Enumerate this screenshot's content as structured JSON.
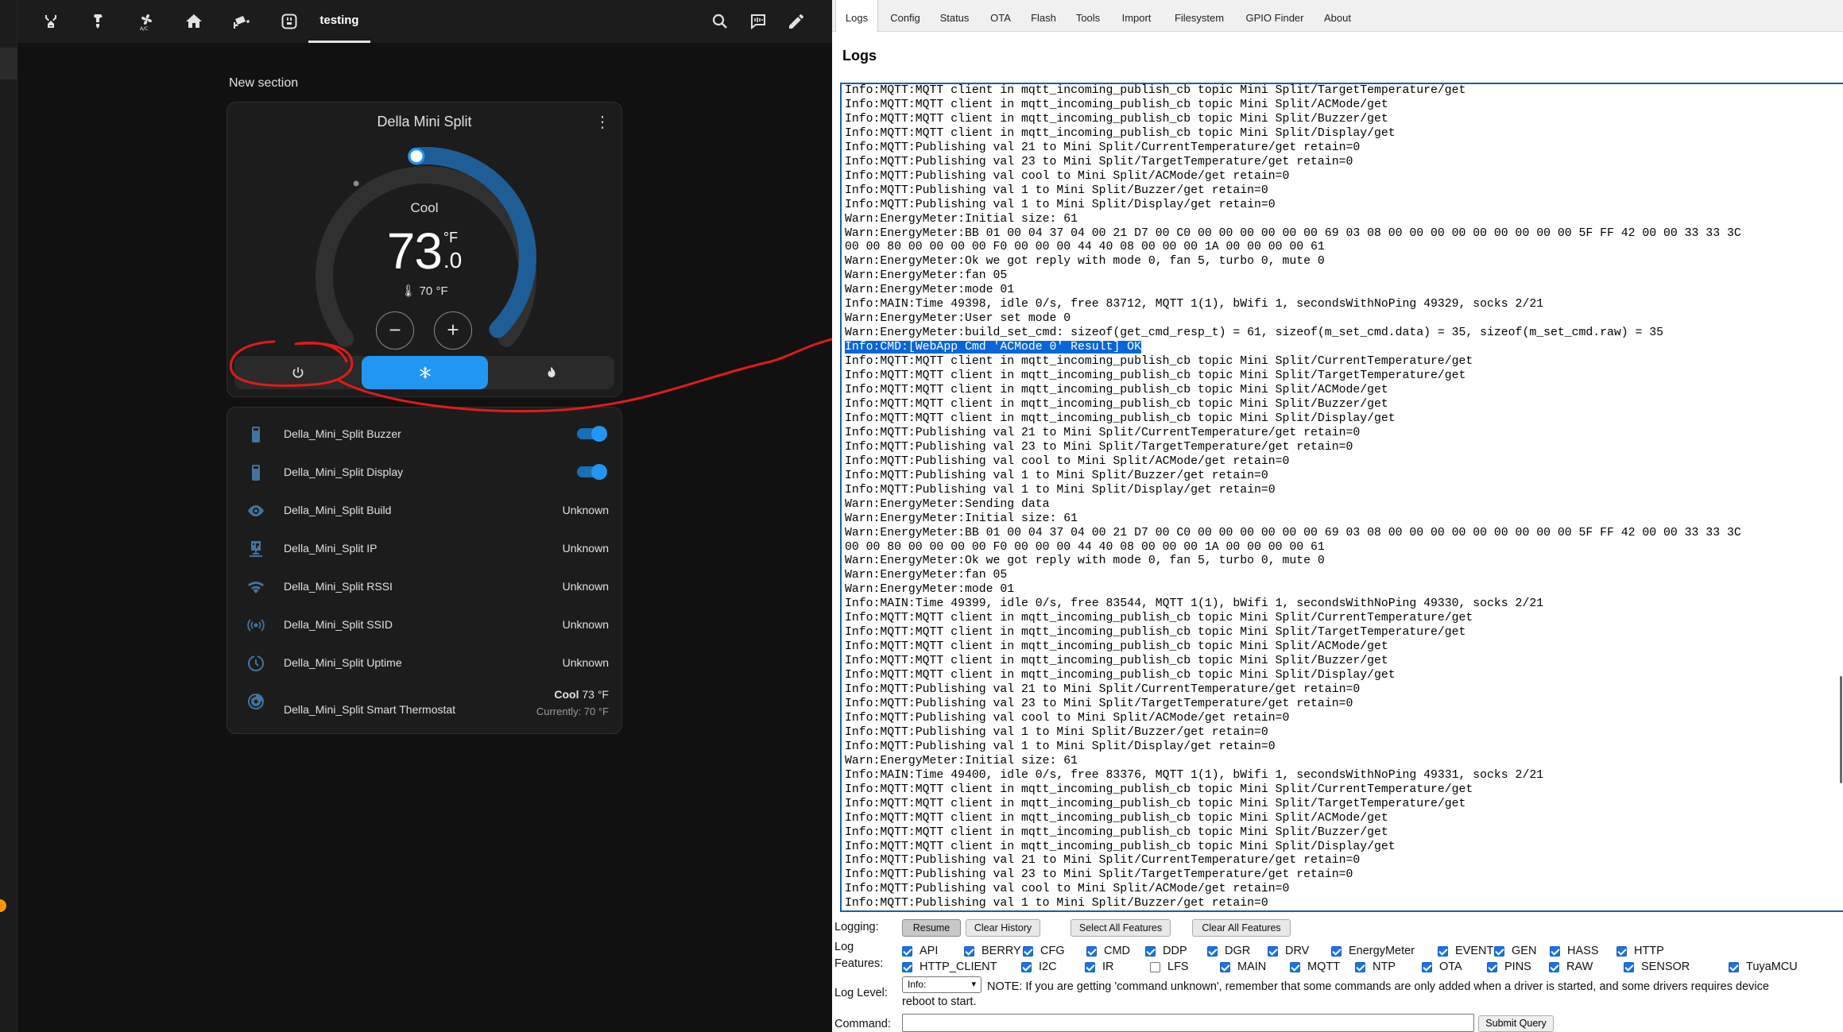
{
  "ha": {
    "tabs": [
      {
        "icon": "robot-vacuum-icon"
      },
      {
        "icon": "water-pump-icon"
      },
      {
        "icon": "ac-fan-icon"
      },
      {
        "icon": "home-icon"
      },
      {
        "icon": "cctv-icon"
      },
      {
        "icon": "power-socket-icon"
      },
      {
        "label": "testing",
        "active": true
      }
    ],
    "top_actions": [
      "search-icon",
      "assist-icon",
      "edit-pencil-icon"
    ],
    "section_title": "New section",
    "thermostat": {
      "name": "Della Mini Split",
      "mode_label": "Cool",
      "target_whole": "73",
      "target_decimal": ".0",
      "unit": "°F",
      "current": "70 °F",
      "minus": "−",
      "plus": "+",
      "modes": [
        "power-icon",
        "snowflake-icon",
        "fire-icon"
      ],
      "selected_mode": "cool",
      "dial_value": 73
    },
    "entities": [
      {
        "icon": "remote-icon",
        "name": "Della_Mini_Split Buzzer",
        "toggle": true
      },
      {
        "icon": "remote-icon",
        "name": "Della_Mini_Split Display",
        "toggle": true
      },
      {
        "icon": "eye-icon",
        "name": "Della_Mini_Split Build",
        "state": "Unknown"
      },
      {
        "icon": "ip-network-icon",
        "name": "Della_Mini_Split IP",
        "state": "Unknown"
      },
      {
        "icon": "wifi-icon",
        "name": "Della_Mini_Split RSSI",
        "state": "Unknown"
      },
      {
        "icon": "access-point-icon",
        "name": "Della_Mini_Split SSID",
        "state": "Unknown"
      },
      {
        "icon": "clock-icon",
        "name": "Della_Mini_Split Uptime",
        "state": "Unknown"
      },
      {
        "icon": "thermostat-icon",
        "name": "Della_Mini_Split Smart Thermostat",
        "state_bold": "Cool",
        "state_value": " 73 °F",
        "state_sub": "Currently: 70 °F"
      }
    ],
    "colors": {
      "accent": "#2196f3",
      "annotation": "#e01b1b"
    }
  },
  "obk": {
    "nav": [
      "Logs",
      "Config",
      "Status",
      "OTA",
      "Flash",
      "Tools",
      "Import",
      "Filesystem",
      "GPIO Finder",
      "About"
    ],
    "heading": "Logs",
    "log_lines": [
      "Info:MQTT:MQTT client in mqtt_incoming_publish_cb topic Mini Split/TargetTemperature/get",
      "Info:MQTT:MQTT client in mqtt_incoming_publish_cb topic Mini Split/ACMode/get",
      "Info:MQTT:MQTT client in mqtt_incoming_publish_cb topic Mini Split/Buzzer/get",
      "Info:MQTT:MQTT client in mqtt_incoming_publish_cb topic Mini Split/Display/get",
      "Info:MQTT:Publishing val 21 to Mini Split/CurrentTemperature/get retain=0",
      "Info:MQTT:Publishing val 23 to Mini Split/TargetTemperature/get retain=0",
      "Info:MQTT:Publishing val cool to Mini Split/ACMode/get retain=0",
      "Info:MQTT:Publishing val 1 to Mini Split/Buzzer/get retain=0",
      "Info:MQTT:Publishing val 1 to Mini Split/Display/get retain=0",
      "Warn:EnergyMeter:Initial size: 61",
      "Warn:EnergyMeter:BB 01 00 04 37 04 00 21 D7 00 C0 00 00 00 00 00 00 69 03 08 00 00 00 00 00 00 00 00 00 5F FF 42 00 00 33 33 3C",
      "00 00 80 00 00 00 00 F0 00 00 00 44 40 08 00 00 00 1A 00 00 00 00 61",
      "Warn:EnergyMeter:Ok we got reply with mode 0, fan 5, turbo 0, mute 0",
      "Warn:EnergyMeter:fan 05",
      "Warn:EnergyMeter:mode 01",
      "Info:MAIN:Time 49398, idle 0/s, free 83712, MQTT 1(1), bWifi 1, secondsWithNoPing 49329, socks 2/21",
      "Warn:EnergyMeter:User set mode 0",
      "Warn:EnergyMeter:build_set_cmd: sizeof(get_cmd_resp_t) = 61, sizeof(m_set_cmd.data) = 35, sizeof(m_set_cmd.raw) = 35",
      "Info:CMD:[WebApp Cmd 'ACMode 0' Result] OK",
      "Info:MQTT:MQTT client in mqtt_incoming_publish_cb topic Mini Split/CurrentTemperature/get",
      "Info:MQTT:MQTT client in mqtt_incoming_publish_cb topic Mini Split/TargetTemperature/get",
      "Info:MQTT:MQTT client in mqtt_incoming_publish_cb topic Mini Split/ACMode/get",
      "Info:MQTT:MQTT client in mqtt_incoming_publish_cb topic Mini Split/Buzzer/get",
      "Info:MQTT:MQTT client in mqtt_incoming_publish_cb topic Mini Split/Display/get",
      "Info:MQTT:Publishing val 21 to Mini Split/CurrentTemperature/get retain=0",
      "Info:MQTT:Publishing val 23 to Mini Split/TargetTemperature/get retain=0",
      "Info:MQTT:Publishing val cool to Mini Split/ACMode/get retain=0",
      "Info:MQTT:Publishing val 1 to Mini Split/Buzzer/get retain=0",
      "Info:MQTT:Publishing val 1 to Mini Split/Display/get retain=0",
      "Warn:EnergyMeter:Sending data",
      "Warn:EnergyMeter:Initial size: 61",
      "Warn:EnergyMeter:BB 01 00 04 37 04 00 21 D7 00 C0 00 00 00 00 00 00 69 03 08 00 00 00 00 00 00 00 00 00 5F FF 42 00 00 33 33 3C",
      "00 00 80 00 00 00 00 F0 00 00 00 44 40 08 00 00 00 1A 00 00 00 00 61",
      "Warn:EnergyMeter:Ok we got reply with mode 0, fan 5, turbo 0, mute 0",
      "Warn:EnergyMeter:fan 05",
      "Warn:EnergyMeter:mode 01",
      "Info:MAIN:Time 49399, idle 0/s, free 83544, MQTT 1(1), bWifi 1, secondsWithNoPing 49330, socks 2/21",
      "Info:MQTT:MQTT client in mqtt_incoming_publish_cb topic Mini Split/CurrentTemperature/get",
      "Info:MQTT:MQTT client in mqtt_incoming_publish_cb topic Mini Split/TargetTemperature/get",
      "Info:MQTT:MQTT client in mqtt_incoming_publish_cb topic Mini Split/ACMode/get",
      "Info:MQTT:MQTT client in mqtt_incoming_publish_cb topic Mini Split/Buzzer/get",
      "Info:MQTT:MQTT client in mqtt_incoming_publish_cb topic Mini Split/Display/get",
      "Info:MQTT:Publishing val 21 to Mini Split/CurrentTemperature/get retain=0",
      "Info:MQTT:Publishing val 23 to Mini Split/TargetTemperature/get retain=0",
      "Info:MQTT:Publishing val cool to Mini Split/ACMode/get retain=0",
      "Info:MQTT:Publishing val 1 to Mini Split/Buzzer/get retain=0",
      "Info:MQTT:Publishing val 1 to Mini Split/Display/get retain=0",
      "Warn:EnergyMeter:Initial size: 61",
      "Info:MAIN:Time 49400, idle 0/s, free 83376, MQTT 1(1), bWifi 1, secondsWithNoPing 49331, socks 2/21",
      "Info:MQTT:MQTT client in mqtt_incoming_publish_cb topic Mini Split/CurrentTemperature/get",
      "Info:MQTT:MQTT client in mqtt_incoming_publish_cb topic Mini Split/TargetTemperature/get",
      "Info:MQTT:MQTT client in mqtt_incoming_publish_cb topic Mini Split/ACMode/get",
      "Info:MQTT:MQTT client in mqtt_incoming_publish_cb topic Mini Split/Buzzer/get",
      "Info:MQTT:MQTT client in mqtt_incoming_publish_cb topic Mini Split/Display/get",
      "Info:MQTT:Publishing val 21 to Mini Split/CurrentTemperature/get retain=0",
      "Info:MQTT:Publishing val 23 to Mini Split/TargetTemperature/get retain=0",
      "Info:MQTT:Publishing val cool to Mini Split/ACMode/get retain=0",
      "Info:MQTT:Publishing val 1 to Mini Split/Buzzer/get retain=0"
    ],
    "highlighted_line": 18,
    "logging_label": "Logging:",
    "buttons": [
      "Resume",
      "Clear History",
      "Select All Features",
      "Clear All Features"
    ],
    "log_features_label_1": "Log",
    "log_features_label_2": "Features:",
    "features_row1": [
      {
        "name": "API",
        "checked": true
      },
      {
        "name": "BERRY",
        "checked": true
      },
      {
        "name": "CFG",
        "checked": true
      },
      {
        "name": "CMD",
        "checked": true
      },
      {
        "name": "DDP",
        "checked": true
      },
      {
        "name": "DGR",
        "checked": true
      },
      {
        "name": "DRV",
        "checked": true
      },
      {
        "name": "EnergyMeter",
        "checked": true
      },
      {
        "name": "EVENT",
        "checked": true
      },
      {
        "name": "GEN",
        "checked": true
      },
      {
        "name": "HASS",
        "checked": true
      },
      {
        "name": "HTTP",
        "checked": true
      }
    ],
    "features_row2": [
      {
        "name": "HTTP_CLIENT",
        "checked": true
      },
      {
        "name": "I2C",
        "checked": true
      },
      {
        "name": "IR",
        "checked": true
      },
      {
        "name": "LFS",
        "checked": false
      },
      {
        "name": "MAIN",
        "checked": true
      },
      {
        "name": "MQTT",
        "checked": true
      },
      {
        "name": "NTP",
        "checked": true
      },
      {
        "name": "OTA",
        "checked": true
      },
      {
        "name": "PINS",
        "checked": true
      },
      {
        "name": "RAW",
        "checked": true
      },
      {
        "name": "SENSOR",
        "checked": true
      },
      {
        "name": "TuyaMCU",
        "checked": true
      }
    ],
    "log_level_label": "Log Level:",
    "log_level_value": "Info:",
    "note_line1": "NOTE: If you are getting 'command unknown', remember that some commands are only added when a driver is started, and some drivers requires device",
    "note_line2": "reboot to start.",
    "command_label": "Command:",
    "command_value": "",
    "submit_label": "Submit Query"
  }
}
